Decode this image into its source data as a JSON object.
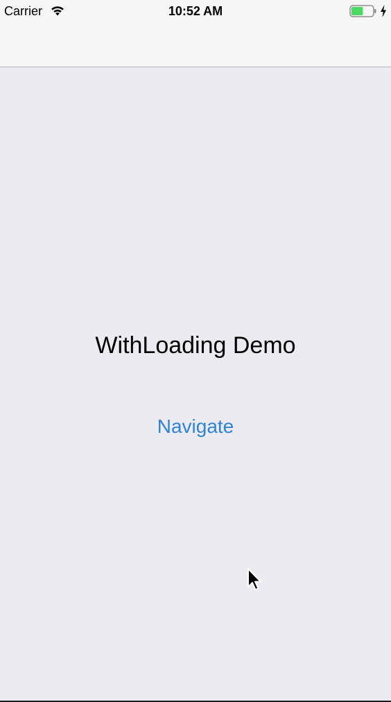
{
  "status_bar": {
    "carrier": "Carrier",
    "time": "10:52 AM",
    "wifi_icon": "wifi-icon",
    "battery_icon": "battery-icon",
    "battery_level": 0.55,
    "battery_color": "#4cd964",
    "charging_icon": "lightning-icon"
  },
  "nav_bar": {
    "title": ""
  },
  "main": {
    "title": "WithLoading Demo",
    "navigate_label": "Navigate",
    "accent_color": "#2e84d9"
  },
  "pointer": {
    "icon": "mouse-pointer-icon"
  }
}
